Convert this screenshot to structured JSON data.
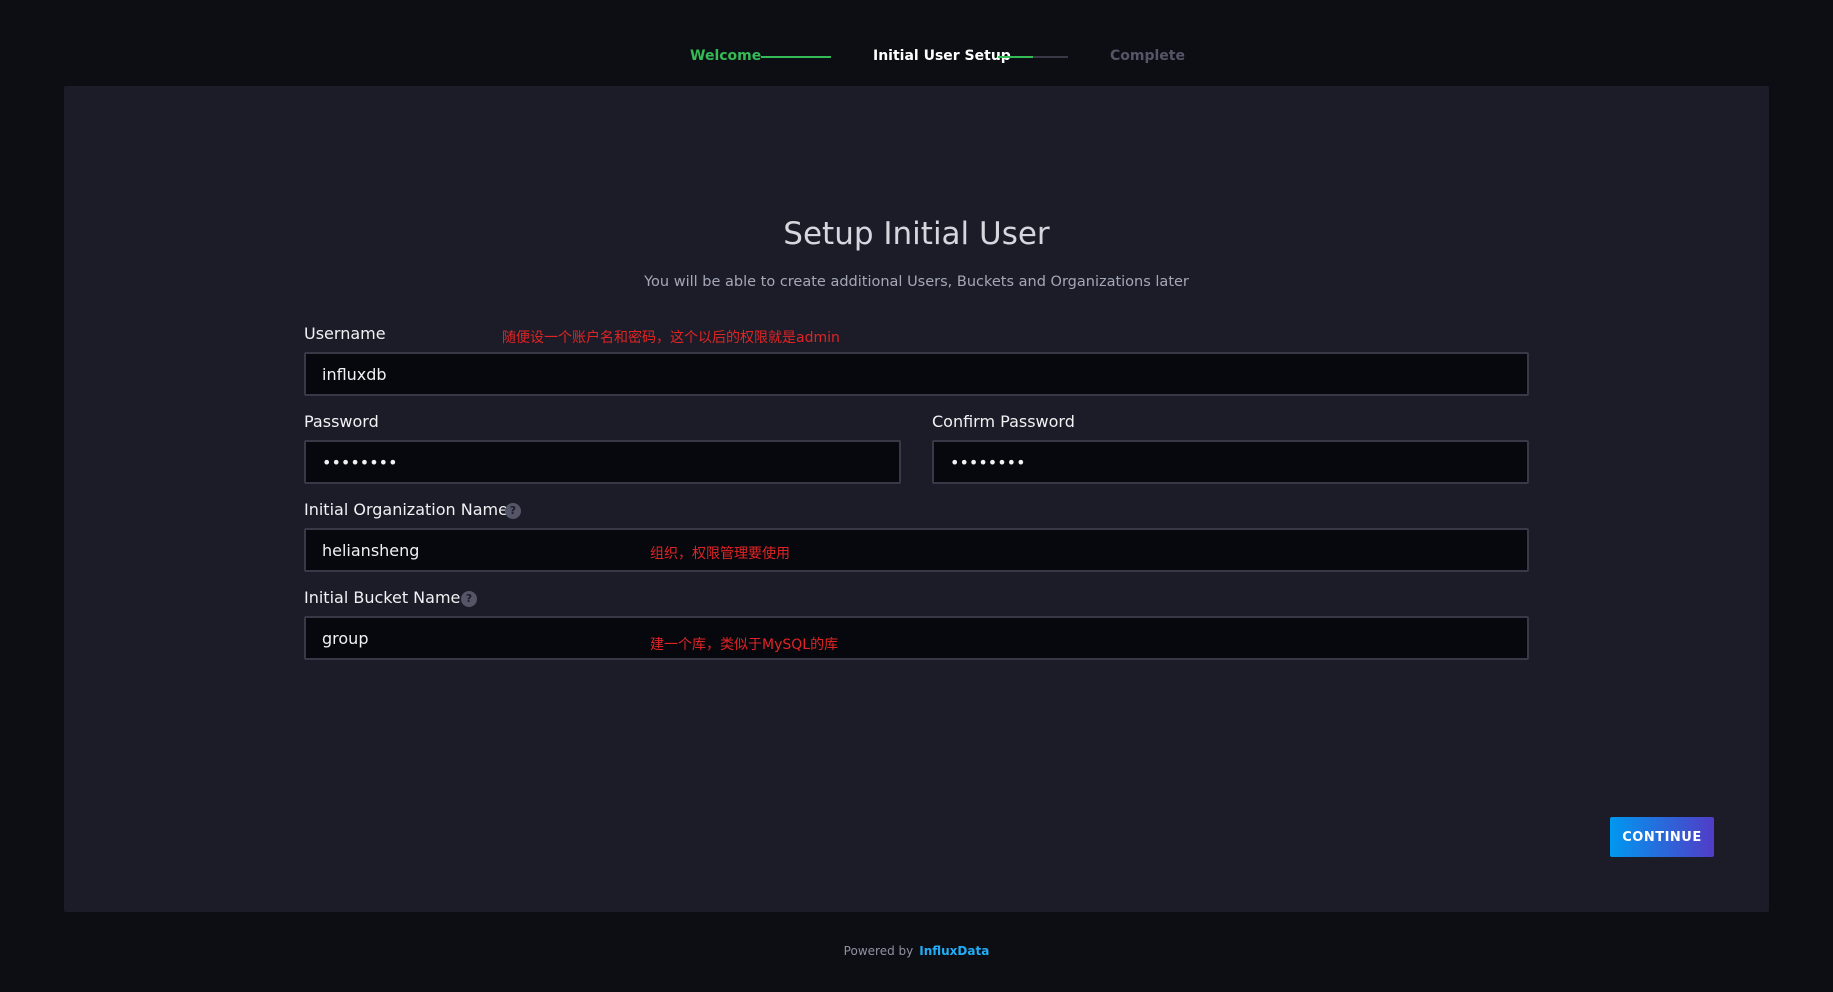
{
  "steps": {
    "items": [
      {
        "label": "Welcome",
        "state": "done"
      },
      {
        "label": "Initial User Setup",
        "state": "current"
      },
      {
        "label": "Complete",
        "state": "pending"
      }
    ],
    "connector_progress": [
      1.0,
      0.5
    ]
  },
  "form": {
    "title": "Setup Initial User",
    "subtitle": "You will be able to create additional Users, Buckets and Organizations later",
    "username": {
      "label": "Username",
      "value": "influxdb"
    },
    "password": {
      "label": "Password",
      "value": "••••••••"
    },
    "confirm_password": {
      "label": "Confirm Password",
      "value": "••••••••"
    },
    "organization": {
      "label": "Initial Organization Name",
      "value": "heliansheng",
      "help_icon": "question-icon"
    },
    "bucket": {
      "label": "Initial Bucket Name",
      "value": "group",
      "help_icon": "question-icon"
    },
    "continue_label": "CONTINUE"
  },
  "annotations": {
    "username_note": "随便设一个账户名和密码，这个以后的权限就是admin",
    "organization_note": "组织，权限管理要使用",
    "bucket_note": "建一个库，类似于MySQL的库"
  },
  "footer": {
    "powered_by": "Powered by",
    "brand": "InfluxData"
  },
  "colors": {
    "background": "#0d0e14",
    "panel": "#1c1c29",
    "step_done": "#34bb55",
    "accent_gradient_start": "#0098f0",
    "accent_gradient_end": "#513cc6",
    "annotation": "#e02424"
  }
}
